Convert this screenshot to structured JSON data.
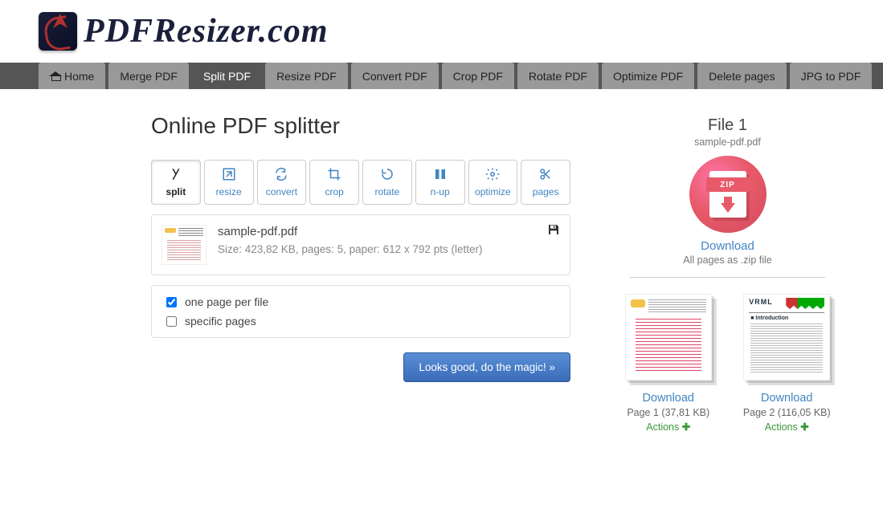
{
  "brand": "PDFResizer.com",
  "nav": {
    "home": "Home",
    "items": [
      "Merge PDF",
      "Split PDF",
      "Resize PDF",
      "Convert PDF",
      "Crop PDF",
      "Rotate PDF",
      "Optimize PDF",
      "Delete pages",
      "JPG to PDF"
    ],
    "active_index": 1
  },
  "page": {
    "title": "Online PDF splitter"
  },
  "tools": [
    {
      "key": "split",
      "label": "split",
      "active": true
    },
    {
      "key": "resize",
      "label": "resize",
      "active": false
    },
    {
      "key": "convert",
      "label": "convert",
      "active": false
    },
    {
      "key": "crop",
      "label": "crop",
      "active": false
    },
    {
      "key": "rotate",
      "label": "rotate",
      "active": false
    },
    {
      "key": "n-up",
      "label": "n-up",
      "active": false
    },
    {
      "key": "optimize",
      "label": "optimize",
      "active": false
    },
    {
      "key": "pages",
      "label": "pages",
      "active": false
    }
  ],
  "file": {
    "name": "sample-pdf.pdf",
    "meta": "Size: 423,82 KB, pages: 5, paper: 612 x 792 pts (letter)"
  },
  "options": {
    "one_per_file": {
      "label": "one page per file",
      "checked": true
    },
    "specific": {
      "label": "specific pages",
      "checked": false
    }
  },
  "action": {
    "magic": "Looks good, do the magic! »"
  },
  "result": {
    "heading": "File 1",
    "filename": "sample-pdf.pdf",
    "zip_badge": "ZIP",
    "download": "Download",
    "download_sub": "All pages as .zip file",
    "pages": [
      {
        "download": "Download",
        "meta": "Page 1 (37,81 KB)",
        "actions": "Actions"
      },
      {
        "download": "Download",
        "meta": "Page 2 (116,05 KB)",
        "actions": "Actions"
      }
    ]
  }
}
